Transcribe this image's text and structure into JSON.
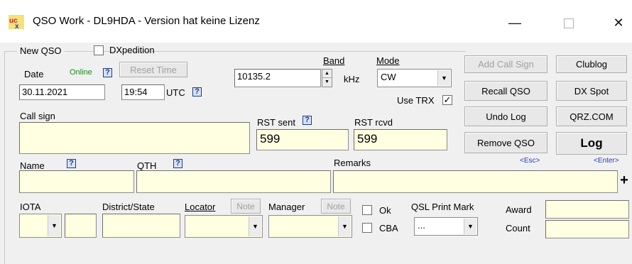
{
  "window": {
    "title": "QSO Work - DL9HDA - Version hat keine Lizenz",
    "app_icon": "ucx-logo-icon",
    "controls": {
      "minimize": "—",
      "close": "✕"
    }
  },
  "group": {
    "label": "New QSO"
  },
  "dxpedition": {
    "label": "DXpedition",
    "checked": false
  },
  "date": {
    "label": "Date",
    "status": "Online",
    "value": "30.11.2021"
  },
  "reset_time": {
    "label": "Reset Time"
  },
  "time": {
    "value": "19:54",
    "unit": "UTC"
  },
  "help": {
    "glyph": "?"
  },
  "band": {
    "label": "Band",
    "value": "10135.2",
    "unit": "kHz"
  },
  "mode": {
    "label": "Mode",
    "value": "CW"
  },
  "use_trx": {
    "label": "Use TRX",
    "checked": true
  },
  "buttons": {
    "add_call_sign": "Add Call Sign",
    "clublog": "Clublog",
    "recall_qso": "Recall QSO",
    "dx_spot": "DX Spot",
    "undo_log": "Undo Log",
    "qrz": "QRZ.COM",
    "remove_qso": "Remove QSO",
    "log": "Log"
  },
  "hints": {
    "esc": "<Esc>",
    "enter": "<Enter>"
  },
  "call_sign": {
    "label": "Call sign",
    "value": ""
  },
  "rst_sent": {
    "label": "RST sent",
    "value": "599"
  },
  "rst_rcvd": {
    "label": "RST rcvd",
    "value": "599"
  },
  "name": {
    "label": "Name",
    "value": ""
  },
  "qth": {
    "label": "QTH",
    "value": ""
  },
  "remarks": {
    "label": "Remarks",
    "value": "",
    "plus": "+"
  },
  "iota": {
    "label": "IOTA"
  },
  "district_state": {
    "label": "District/State"
  },
  "locator": {
    "label": "Locator",
    "note": "Note"
  },
  "manager": {
    "label": "Manager",
    "note": "Note"
  },
  "ok": {
    "label": "Ok",
    "checked": false
  },
  "cba": {
    "label": "CBA",
    "checked": false
  },
  "qsl_print_mark": {
    "label": "QSL Print Mark",
    "value": "..."
  },
  "award": {
    "label": "Award",
    "value": ""
  },
  "count": {
    "label": "Count",
    "value": ""
  },
  "colors": {
    "field_bg": "#ffffe1",
    "window_bg": "#f0f0f0",
    "help_blue": "#1c3e8a",
    "online_green": "#1a8a1a"
  }
}
